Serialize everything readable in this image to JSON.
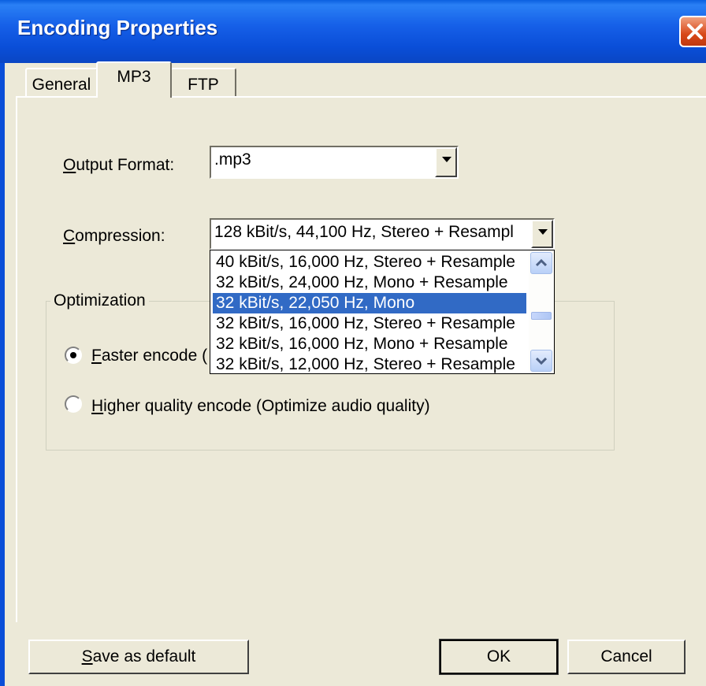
{
  "window": {
    "title": "Encoding Properties"
  },
  "tabs": [
    {
      "label": "General"
    },
    {
      "label": "MP3",
      "active": true
    },
    {
      "label": "FTP"
    }
  ],
  "output_format": {
    "label": "Output Format:",
    "mnemonic": "O",
    "label_rest": "utput Format:",
    "value": ".mp3"
  },
  "compression": {
    "label": "Compression:",
    "mnemonic": "C",
    "label_rest": "ompression:",
    "value": "128 kBit/s, 44,100 Hz, Stereo + Resampl",
    "options": [
      "40 kBit/s, 16,000 Hz, Stereo + Resample",
      "32 kBit/s, 24,000 Hz, Mono + Resample",
      "32 kBit/s, 22,050 Hz, Mono",
      "32 kBit/s, 16,000 Hz, Stereo + Resample",
      "32 kBit/s, 16,000 Hz, Mono + Resample",
      "32 kBit/s, 12,000 Hz, Stereo + Resample"
    ],
    "highlighted_option": "32 kBit/s, 22,050 Hz, Mono"
  },
  "optimization": {
    "title": "Optimization",
    "faster": {
      "mnemonic": "F",
      "label_rest": "aster encode (",
      "selected": true
    },
    "higher": {
      "mnemonic": "H",
      "label_rest": "igher quality encode (Optimize audio quality)",
      "selected": false
    }
  },
  "buttons": {
    "save_default": {
      "mnemonic": "S",
      "label_rest": "ave as default"
    },
    "ok": "OK",
    "cancel": "Cancel"
  }
}
